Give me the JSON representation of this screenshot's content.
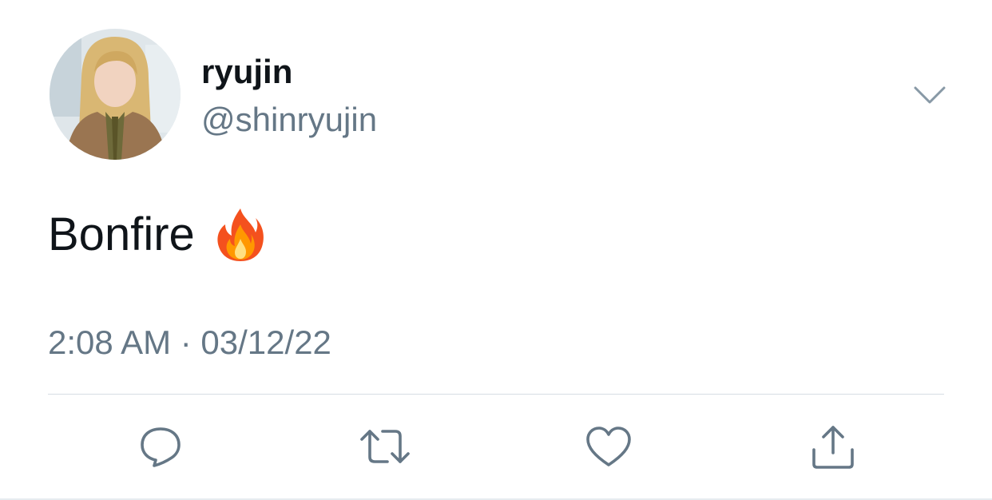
{
  "tweet": {
    "author": {
      "display_name": "ryujin",
      "handle": "@shinryujin",
      "avatar": "profile-photo"
    },
    "text": "Bonfire",
    "emoji": "fire-emoji",
    "timestamp": "2:08 AM · 03/12/22",
    "menu_icon": "chevron-down-icon",
    "actions": [
      {
        "name": "reply",
        "icon": "comment-icon"
      },
      {
        "name": "retweet",
        "icon": "retweet-icon"
      },
      {
        "name": "like",
        "icon": "heart-icon"
      },
      {
        "name": "share",
        "icon": "share-icon"
      }
    ]
  },
  "colors": {
    "primary_text": "#0f1419",
    "secondary_text": "#657786",
    "icon": "#657786",
    "divider": "#d6dde3"
  }
}
